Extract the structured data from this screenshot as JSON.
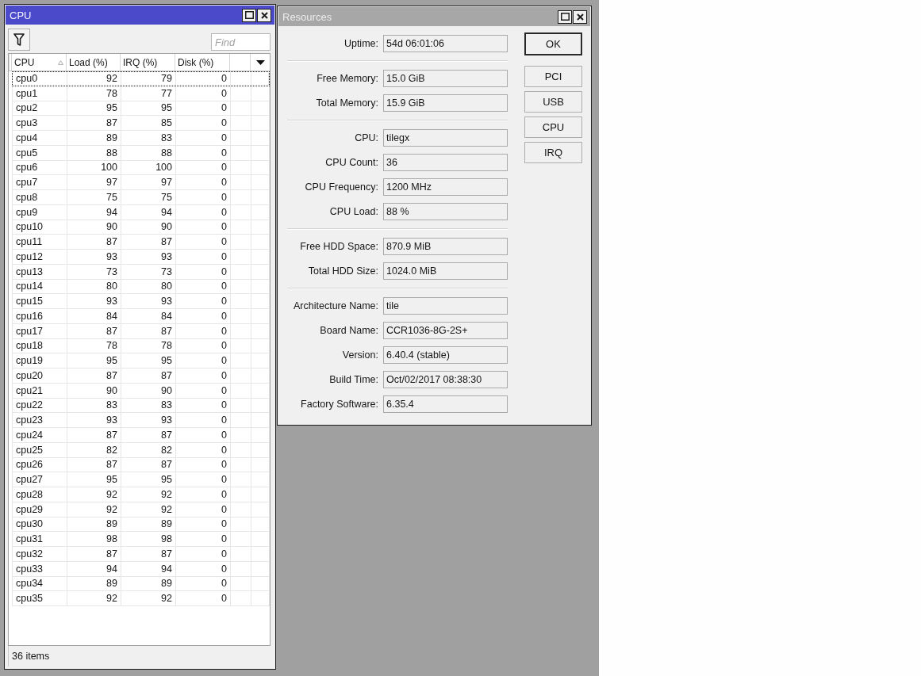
{
  "cpu_window": {
    "title": "CPU",
    "active": true,
    "toolbar": {
      "find": {
        "placeholder": "Find"
      }
    },
    "table": {
      "columns": [
        {
          "label": "CPU",
          "sorted": true
        },
        {
          "label": "Load (%)",
          "sorted": false
        },
        {
          "label": "IRQ (%)",
          "sorted": false
        },
        {
          "label": "Disk (%)",
          "sorted": false
        }
      ],
      "rows": [
        {
          "cells": [
            "cpu0",
            "92",
            "79",
            "0"
          ],
          "selected": true
        },
        {
          "cells": [
            "cpu1",
            "78",
            "77",
            "0"
          ],
          "selected": false
        },
        {
          "cells": [
            "cpu2",
            "95",
            "95",
            "0"
          ],
          "selected": false
        },
        {
          "cells": [
            "cpu3",
            "87",
            "85",
            "0"
          ],
          "selected": false
        },
        {
          "cells": [
            "cpu4",
            "89",
            "83",
            "0"
          ],
          "selected": false
        },
        {
          "cells": [
            "cpu5",
            "88",
            "88",
            "0"
          ],
          "selected": false
        },
        {
          "cells": [
            "cpu6",
            "100",
            "100",
            "0"
          ],
          "selected": false
        },
        {
          "cells": [
            "cpu7",
            "97",
            "97",
            "0"
          ],
          "selected": false
        },
        {
          "cells": [
            "cpu8",
            "75",
            "75",
            "0"
          ],
          "selected": false
        },
        {
          "cells": [
            "cpu9",
            "94",
            "94",
            "0"
          ],
          "selected": false
        },
        {
          "cells": [
            "cpu10",
            "90",
            "90",
            "0"
          ],
          "selected": false
        },
        {
          "cells": [
            "cpu11",
            "87",
            "87",
            "0"
          ],
          "selected": false
        },
        {
          "cells": [
            "cpu12",
            "93",
            "93",
            "0"
          ],
          "selected": false
        },
        {
          "cells": [
            "cpu13",
            "73",
            "73",
            "0"
          ],
          "selected": false
        },
        {
          "cells": [
            "cpu14",
            "80",
            "80",
            "0"
          ],
          "selected": false
        },
        {
          "cells": [
            "cpu15",
            "93",
            "93",
            "0"
          ],
          "selected": false
        },
        {
          "cells": [
            "cpu16",
            "84",
            "84",
            "0"
          ],
          "selected": false
        },
        {
          "cells": [
            "cpu17",
            "87",
            "87",
            "0"
          ],
          "selected": false
        },
        {
          "cells": [
            "cpu18",
            "78",
            "78",
            "0"
          ],
          "selected": false
        },
        {
          "cells": [
            "cpu19",
            "95",
            "95",
            "0"
          ],
          "selected": false
        },
        {
          "cells": [
            "cpu20",
            "87",
            "87",
            "0"
          ],
          "selected": false
        },
        {
          "cells": [
            "cpu21",
            "90",
            "90",
            "0"
          ],
          "selected": false
        },
        {
          "cells": [
            "cpu22",
            "83",
            "83",
            "0"
          ],
          "selected": false
        },
        {
          "cells": [
            "cpu23",
            "93",
            "93",
            "0"
          ],
          "selected": false
        },
        {
          "cells": [
            "cpu24",
            "87",
            "87",
            "0"
          ],
          "selected": false
        },
        {
          "cells": [
            "cpu25",
            "82",
            "82",
            "0"
          ],
          "selected": false
        },
        {
          "cells": [
            "cpu26",
            "87",
            "87",
            "0"
          ],
          "selected": false
        },
        {
          "cells": [
            "cpu27",
            "95",
            "95",
            "0"
          ],
          "selected": false
        },
        {
          "cells": [
            "cpu28",
            "92",
            "92",
            "0"
          ],
          "selected": false
        },
        {
          "cells": [
            "cpu29",
            "92",
            "92",
            "0"
          ],
          "selected": false
        },
        {
          "cells": [
            "cpu30",
            "89",
            "89",
            "0"
          ],
          "selected": false
        },
        {
          "cells": [
            "cpu31",
            "98",
            "98",
            "0"
          ],
          "selected": false
        },
        {
          "cells": [
            "cpu32",
            "87",
            "87",
            "0"
          ],
          "selected": false
        },
        {
          "cells": [
            "cpu33",
            "94",
            "94",
            "0"
          ],
          "selected": false
        },
        {
          "cells": [
            "cpu34",
            "89",
            "89",
            "0"
          ],
          "selected": false
        },
        {
          "cells": [
            "cpu35",
            "92",
            "92",
            "0"
          ],
          "selected": false
        }
      ]
    },
    "status_bar": "36 items"
  },
  "resources_window": {
    "title": "Resources",
    "active": false,
    "sections": [
      {
        "fields": [
          {
            "label": "Uptime:",
            "value": "54d 06:01:06"
          }
        ]
      },
      {
        "fields": [
          {
            "label": "Free Memory:",
            "value": "15.0 GiB"
          },
          {
            "label": "Total Memory:",
            "value": "15.9 GiB"
          }
        ]
      },
      {
        "fields": [
          {
            "label": "CPU:",
            "value": "tilegx"
          },
          {
            "label": "CPU Count:",
            "value": "36"
          },
          {
            "label": "CPU Frequency:",
            "value": "1200 MHz"
          },
          {
            "label": "CPU Load:",
            "value": "88 %"
          }
        ]
      },
      {
        "fields": [
          {
            "label": "Free HDD Space:",
            "value": "870.9 MiB"
          },
          {
            "label": "Total HDD Size:",
            "value": "1024.0 MiB"
          }
        ]
      },
      {
        "fields": [
          {
            "label": "Architecture Name:",
            "value": "tile"
          },
          {
            "label": "Board Name:",
            "value": "CCR1036-8G-2S+"
          },
          {
            "label": "Version:",
            "value": "6.40.4 (stable)"
          },
          {
            "label": "Build Time:",
            "value": "Oct/02/2017 08:38:30"
          },
          {
            "label": "Factory Software:",
            "value": "6.35.4"
          }
        ]
      }
    ],
    "buttons": [
      {
        "label": "OK",
        "default": true
      },
      {
        "label": "PCI",
        "default": false
      },
      {
        "label": "USB",
        "default": false
      },
      {
        "label": "CPU",
        "default": false
      },
      {
        "label": "IRQ",
        "default": false
      }
    ]
  }
}
